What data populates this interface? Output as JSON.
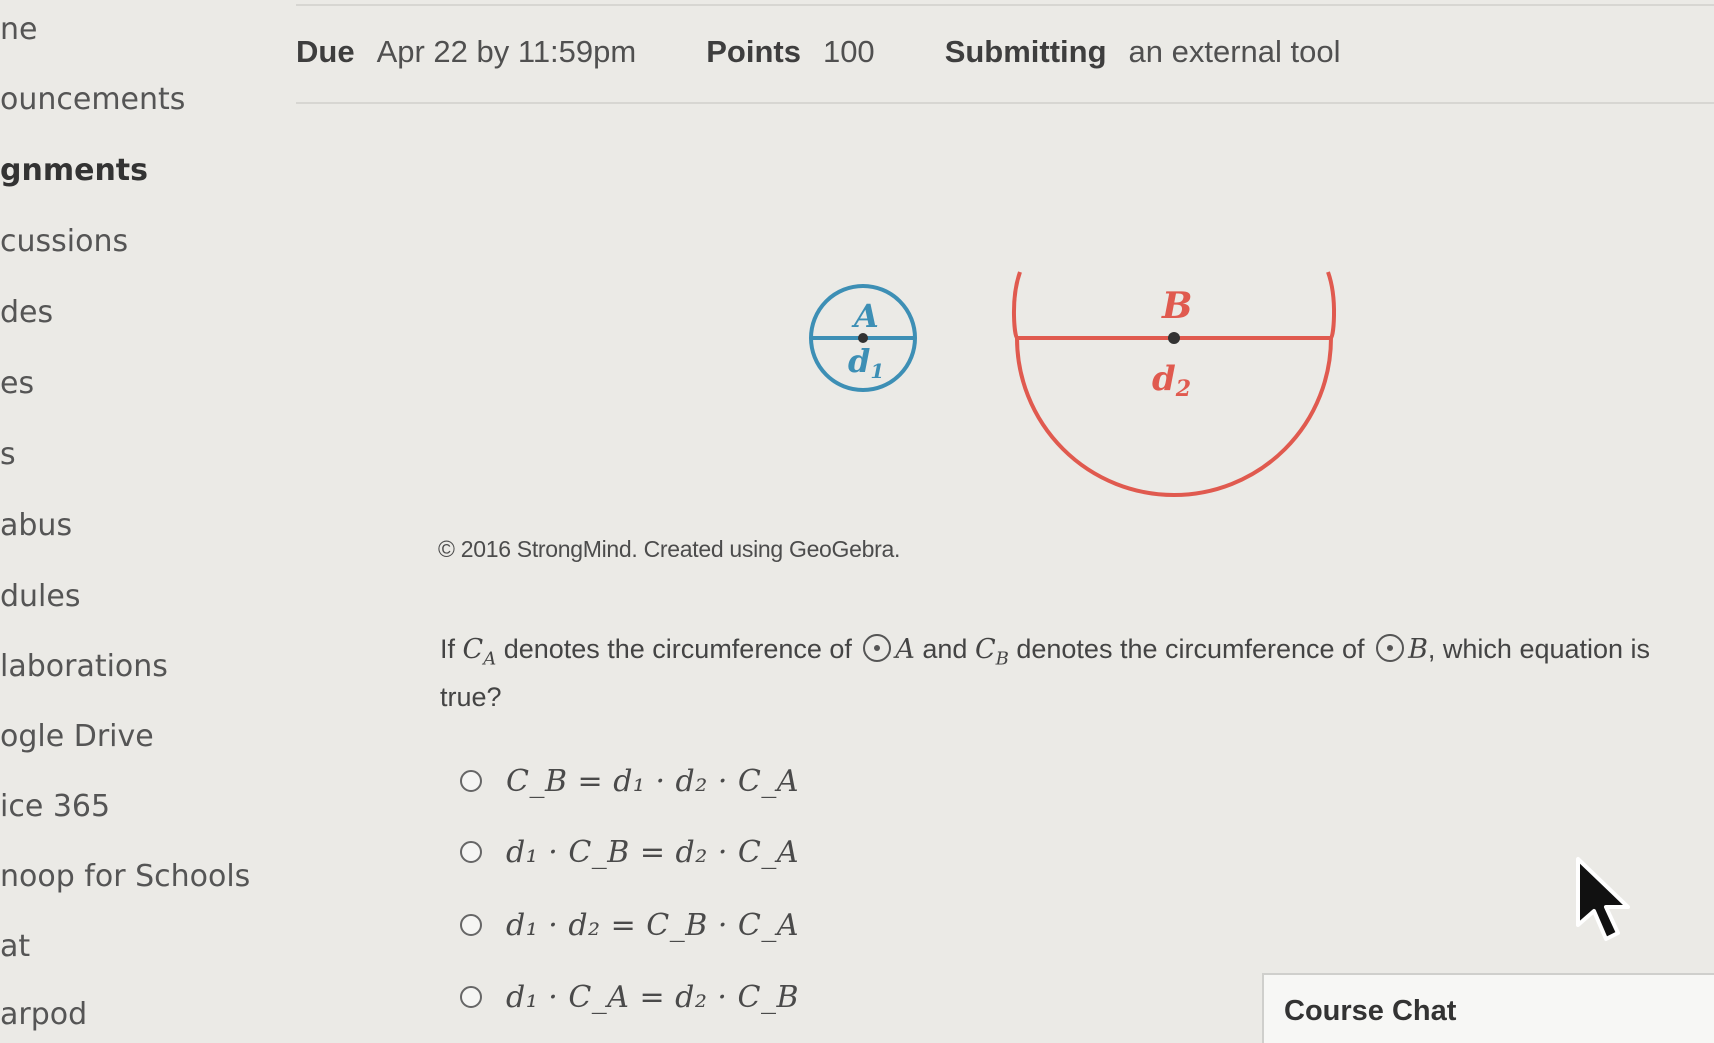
{
  "sidebar": {
    "items": [
      {
        "label": "ne"
      },
      {
        "label": "ouncements"
      },
      {
        "label": "gnments"
      },
      {
        "label": "cussions"
      },
      {
        "label": "des"
      },
      {
        "label": "es"
      },
      {
        "label": "s"
      },
      {
        "label": "abus"
      },
      {
        "label": "dules"
      },
      {
        "label": "laborations"
      },
      {
        "label": "ogle Drive"
      },
      {
        "label": "ice 365"
      },
      {
        "label": "noop for Schools"
      },
      {
        "label": "at"
      },
      {
        "label": "arpod"
      }
    ]
  },
  "details": {
    "due_label": "Due",
    "due_value": "Apr 22 by 11:59pm",
    "points_label": "Points",
    "points_value": "100",
    "submitting_label": "Submitting",
    "submitting_value": "an external tool"
  },
  "figure": {
    "circle_a_label": "A",
    "circle_a_diameter": "d",
    "circle_a_sub": "1",
    "circle_b_label": "B",
    "circle_b_diameter": "d",
    "circle_b_sub": "2",
    "caption": "© 2016 StrongMind. Created using GeoGebra.",
    "colors": {
      "circle_a": "#3d8fb5",
      "circle_b": "#e05a4f"
    }
  },
  "question": {
    "t1": "If ",
    "ca": "C",
    "ca_sub": "A",
    "t2": " denotes the circumference of ",
    "a": "A",
    "t3": " and ",
    "cb": "C",
    "cb_sub": "B",
    "t4": " denotes the circumference of ",
    "b": "B",
    "t5": ", which equation is true?"
  },
  "options": [
    {
      "text": "C_B = d₁ · d₂ · C_A"
    },
    {
      "text": "d₁ · C_B = d₂ · C_A"
    },
    {
      "text": "d₁ · d₂ = C_B · C_A"
    },
    {
      "text": "d₁ · C_A = d₂ · C_B"
    }
  ],
  "chat": {
    "label": "Course Chat"
  }
}
